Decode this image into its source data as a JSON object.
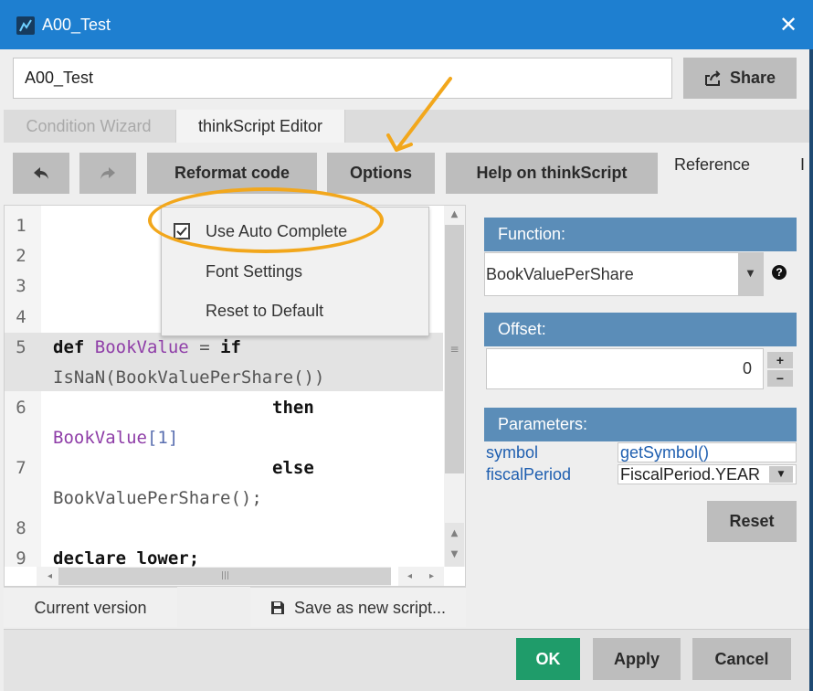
{
  "window": {
    "title": "A00_Test",
    "close_glyph": "✕"
  },
  "name_field": {
    "value": "A00_Test"
  },
  "share_label": "Share",
  "tabs": {
    "wizard": "Condition Wizard",
    "editor": "thinkScript Editor"
  },
  "toolbar": {
    "reformat": "Reformat code",
    "options": "Options",
    "help": "Help on thinkScript",
    "reference": "Reference",
    "truncated_tab": "I"
  },
  "options_menu": {
    "items": [
      "Use Auto Complete",
      "Font Settings",
      "Reset to Default"
    ],
    "auto_complete_checked": true
  },
  "code": {
    "line_numbers": [
      "1",
      "2",
      "3",
      "4",
      "5",
      "6",
      "7",
      "8",
      "9"
    ],
    "l5_kw": "def",
    "l5_name": "BookValue",
    "l5_eq": "=",
    "l5_if": "if",
    "l5_cont": "IsNaN(BookValuePerShare())",
    "l6_then": "then",
    "l6_name": "BookValue",
    "l6_idx": "[1]",
    "l7_else": "else",
    "l7_cont": "BookValuePerShare();",
    "l9": "declare lower;"
  },
  "function_panel": {
    "header": "Function:",
    "selected": "BookValuePerShare"
  },
  "offset_panel": {
    "header": "Offset:",
    "value": "0"
  },
  "parameters_panel": {
    "header": "Parameters:",
    "rows": [
      {
        "name": "symbol",
        "value": "getSymbol()"
      },
      {
        "name": "fiscalPeriod",
        "value": "FiscalPeriod.YEAR"
      }
    ]
  },
  "reset_label": "Reset",
  "bottom": {
    "current_version": "Current version",
    "save_as": "Save as new script..."
  },
  "footer": {
    "ok": "OK",
    "apply": "Apply",
    "cancel": "Cancel"
  },
  "colors": {
    "title_bar": "#1e7fd0",
    "panel_header": "#5b8db8",
    "ok_button": "#1f9c6a",
    "annotation": "#f2a71c",
    "keyword_purple": "#8f3ea8"
  },
  "icons": [
    "app-icon",
    "close-icon",
    "share-icon",
    "undo-icon",
    "redo-icon",
    "checkbox-checked-icon",
    "dropdown-arrow-icon",
    "help-icon",
    "save-icon"
  ]
}
